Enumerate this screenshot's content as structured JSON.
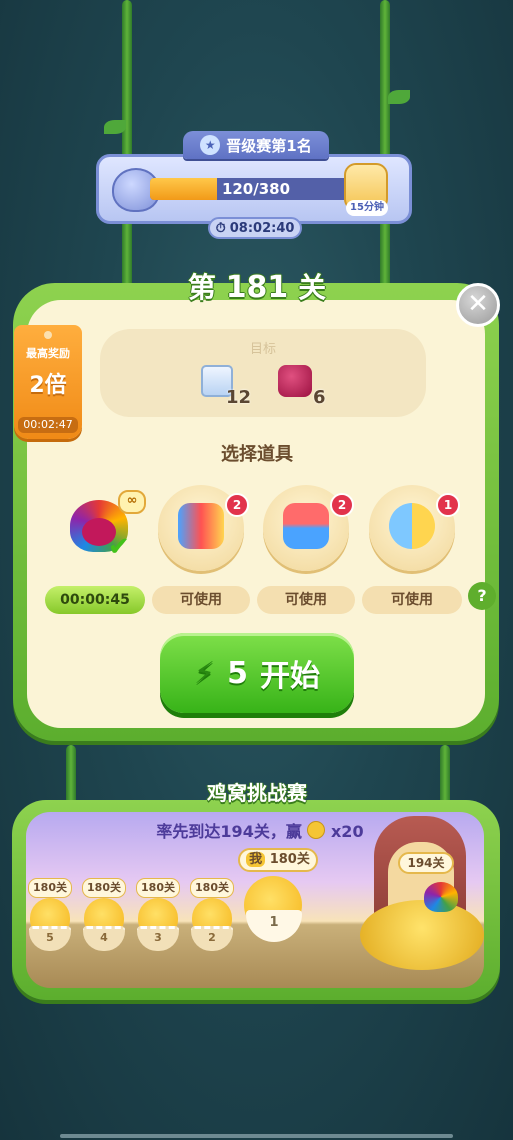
{
  "rank": {
    "title": "晋级赛第1名",
    "progress_current": 120,
    "progress_total": 380,
    "progress_text": "120/380",
    "bottle_badge": "15分钟",
    "timer": "08:02:40"
  },
  "level": {
    "prefix": "第",
    "number": "181",
    "suffix": "关",
    "close_symbol": "✕"
  },
  "reward_tag": {
    "label": "最高奖励",
    "multiplier": "2倍",
    "timer": "00:02:47"
  },
  "goal": {
    "label": "目标",
    "items": [
      {
        "icon": "ice-tile-icon",
        "count": "12"
      },
      {
        "icon": "jam-tile-icon",
        "count": "6"
      }
    ]
  },
  "boosters": {
    "title": "选择道具",
    "items": [
      {
        "icon": "rainbow-owl-icon",
        "badge": "∞",
        "status": "00:00:45",
        "selected": true
      },
      {
        "icon": "rocket-bundle-icon",
        "badge": "2",
        "status": "可使用"
      },
      {
        "icon": "plus-three-moves-icon",
        "badge": "2",
        "status": "可使用"
      },
      {
        "icon": "bird-duo-icon",
        "badge": "1",
        "status": "可使用"
      }
    ],
    "help_symbol": "?"
  },
  "start_button": {
    "cost": "5",
    "label": "开始"
  },
  "nest_challenge": {
    "title": "鸡窝挑战赛",
    "goal_text_prefix": "率先到达194关，赢",
    "goal_reward": "x20",
    "me_label": "我",
    "me_level": "180关",
    "competitors": [
      {
        "level": "180关",
        "rank": "5"
      },
      {
        "level": "180关",
        "rank": "4"
      },
      {
        "level": "180关",
        "rank": "3"
      },
      {
        "level": "180关",
        "rank": "2"
      }
    ],
    "me_rank": "1",
    "target_level": "194关"
  },
  "colors": {
    "frame_green": "#5cae2e",
    "panel_cream": "#fbf4d6",
    "progress_orange": "#f29a18",
    "badge_red": "#e2334c"
  }
}
